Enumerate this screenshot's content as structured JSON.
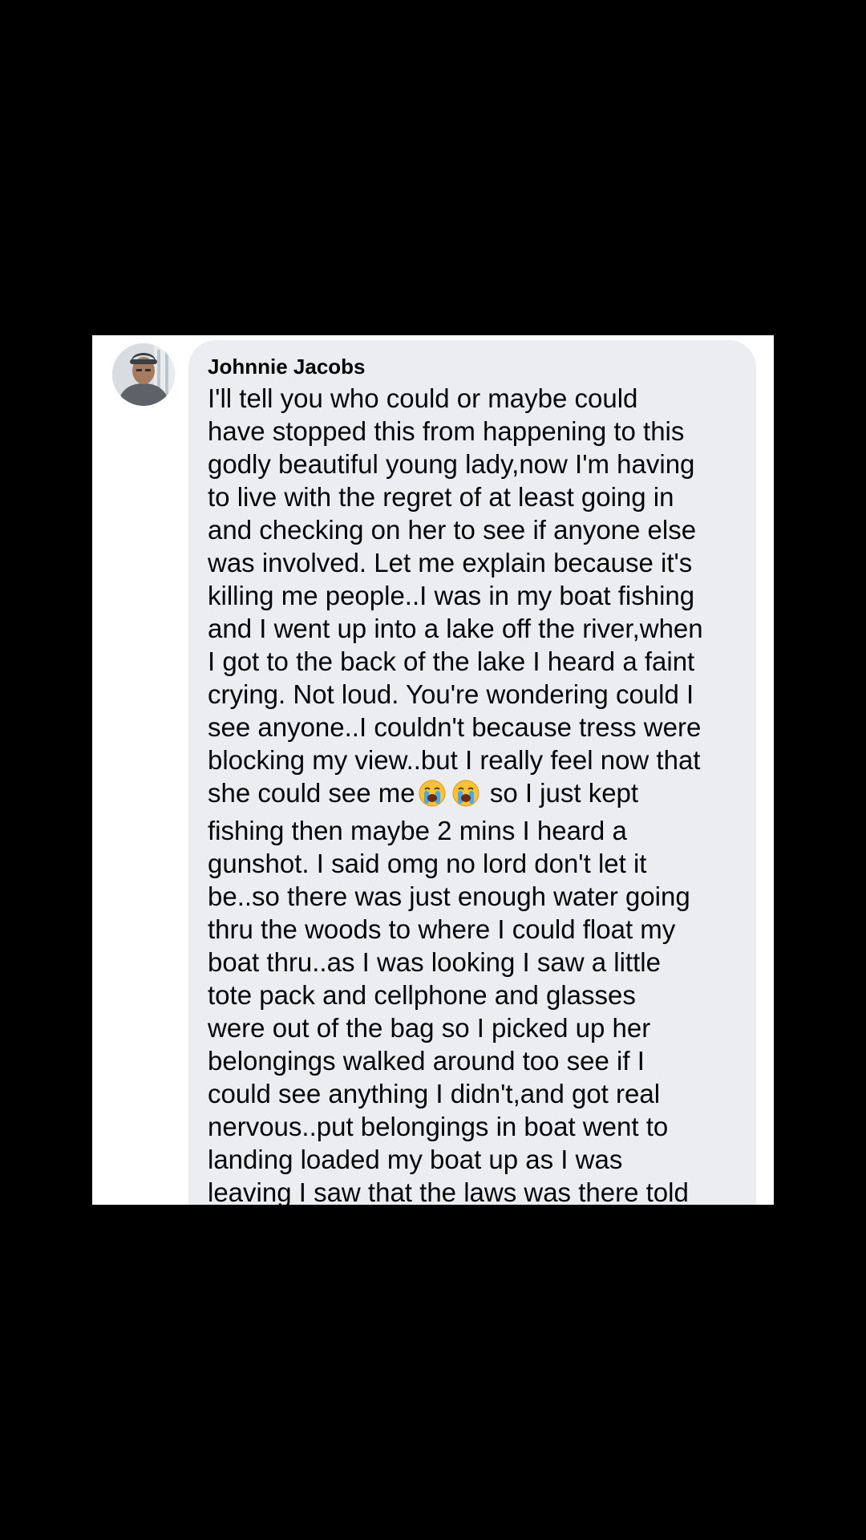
{
  "comment": {
    "author": "Johnnie Jacobs",
    "lines": [
      "I'll tell you who could or maybe could",
      "have stopped this from happening to this",
      "godly beautiful young lady,now I'm having",
      "to live with the regret of at least going in",
      "and checking  on her to see if anyone else",
      "was involved. Let me explain because it's",
      "killing me people..I was in my boat fishing",
      "and I went up into a lake off the river,when",
      "I got to the back of the lake I heard a faint",
      "crying. Not loud. You're wondering could I",
      "see anyone..I couldn't because tress were",
      "blocking my view..but I really feel now that",
      "fishing then maybe 2 mins I heard a",
      "gunshot. I said omg no lord don't let it",
      "be..so there was just enough water going",
      "thru the woods to where I could float my",
      "boat thru..as I was looking I saw a little",
      "tote pack and  cellphone and glasses",
      "were out of the bag so I picked up her",
      "belongings walked around too see if I",
      "could see anything I didn't,and got real",
      "nervous..put belongings in boat went to",
      "landing loaded my boat up as I was",
      "leaving I saw that the laws was there told"
    ],
    "emoji_line": {
      "before": "she could see me",
      "emoji_icon": "loudly-crying-face-emoji",
      "after": " so I just kept"
    }
  },
  "colors": {
    "page_background": "#000000",
    "card_background": "#ffffff",
    "bubble_background": "#ebedf1",
    "text": "#050505"
  }
}
